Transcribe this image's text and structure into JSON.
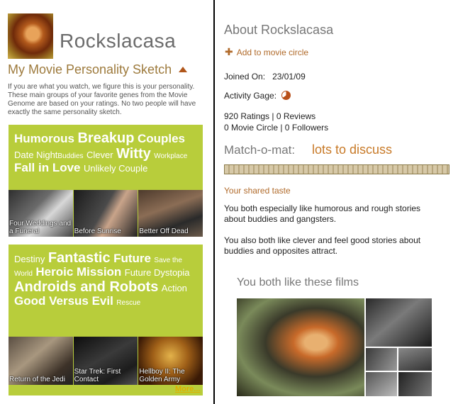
{
  "profile": {
    "username": "Rockslacasa",
    "sketch_title": "My Movie Personality Sketch",
    "sketch_description": "If you are what you watch, we figure this is your personality. These main groups of your favorite genes from the Movie Genome are based on your ratings. No two people will have exactly the same personality sketch."
  },
  "group1": {
    "words": [
      {
        "text": "Humorous",
        "size": "l"
      },
      {
        "text": "Breakup",
        "size": "xl"
      },
      {
        "text": "Couples",
        "size": "l"
      },
      {
        "text": "Date Night",
        "size": "m"
      },
      {
        "text": "Buddies",
        "size": "s"
      },
      {
        "text": "Clever",
        "size": "m"
      },
      {
        "text": "Witty",
        "size": "xl"
      },
      {
        "text": "Workplace",
        "size": "s"
      },
      {
        "text": "Fall in Love",
        "size": "l"
      },
      {
        "text": "Unlikely Couple",
        "size": "m"
      }
    ],
    "films": [
      "Four Weddings and a Funeral",
      "Before Sunrise",
      "Better Off Dead"
    ]
  },
  "group2": {
    "words": [
      {
        "text": "Destiny",
        "size": "m"
      },
      {
        "text": "Fantastic",
        "size": "xl"
      },
      {
        "text": "Future",
        "size": "l"
      },
      {
        "text": "Save the World",
        "size": "s"
      },
      {
        "text": "Heroic Mission",
        "size": "l"
      },
      {
        "text": "Future Dystopia",
        "size": "m"
      },
      {
        "text": "Androids and Robots",
        "size": "xl"
      },
      {
        "text": "Action",
        "size": "m"
      },
      {
        "text": "Good Versus Evil",
        "size": "l"
      },
      {
        "text": "Rescue",
        "size": "s"
      }
    ],
    "films": [
      "Return of the Jedi",
      "Star Trek: First Contact",
      "Hellboy II: The Golden Army"
    ]
  },
  "more_label": "More...",
  "about": {
    "title": "About Rockslacasa",
    "add_circle": "Add to movie circle",
    "joined_label": "Joined On:",
    "joined_value": "23/01/09",
    "activity_label": "Activity Gage:",
    "ratings": "920 Ratings | 0 Reviews",
    "circles": "0 Movie Circle | 0 Followers",
    "match_label": "Match-o-mat:",
    "match_value": "lots to discuss",
    "match_level": 0.0,
    "shared_title": "Your shared taste",
    "shared_para1": "You both especially like humorous and rough stories about buddies and gangsters.",
    "shared_para2": "You also both like clever and feel good stories about buddies and opposites attract.",
    "films_title": "You both like these films"
  },
  "colors": {
    "group_bg": "#b8cd3b",
    "accent": "#c87a28",
    "more_link": "#e0b000"
  }
}
